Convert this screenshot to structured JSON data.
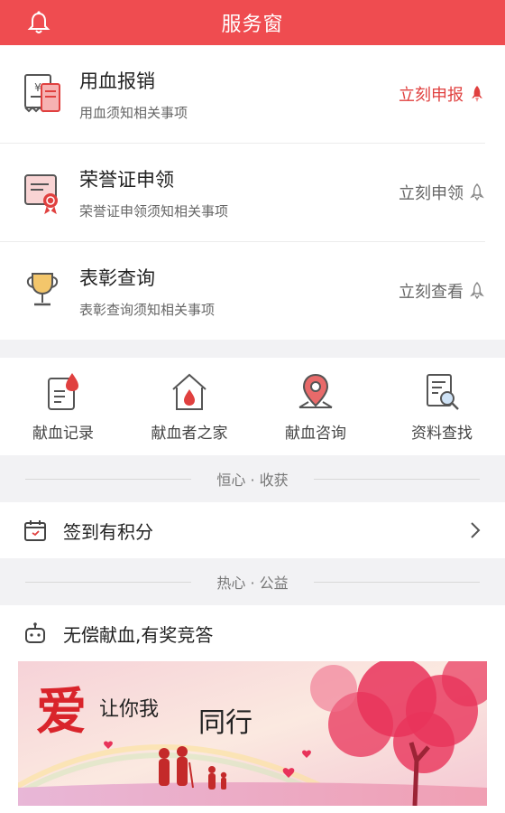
{
  "header": {
    "title": "服务窗",
    "bell_icon": "bell-icon"
  },
  "services": [
    {
      "title": "用血报销",
      "subtitle": "用血须知相关事项",
      "action": "立刻申报",
      "icon": "receipt-icon",
      "primary": true
    },
    {
      "title": "荣誉证申领",
      "subtitle": "荣誉证申领须知相关事项",
      "action": "立刻申领",
      "icon": "certificate-icon",
      "primary": false
    },
    {
      "title": "表彰查询",
      "subtitle": "表彰查询须知相关事项",
      "action": "立刻查看",
      "icon": "trophy-icon",
      "primary": false
    }
  ],
  "grid": [
    {
      "label": "献血记录",
      "icon": "blood-record-icon"
    },
    {
      "label": "献血者之家",
      "icon": "blood-home-icon"
    },
    {
      "label": "献血咨询",
      "icon": "location-pin-icon"
    },
    {
      "label": "资料查找",
      "icon": "document-search-icon"
    }
  ],
  "section1": {
    "divider": "恒心 · 收获",
    "item": "签到有积分"
  },
  "section2": {
    "divider": "热心 · 公益",
    "item": "无偿献血,有奖竞答"
  },
  "banner": {
    "text1": "爱",
    "text2": "让你我",
    "text3": "同行"
  },
  "colors": {
    "accent": "#ef4c50",
    "heart_pink": "#e8335a"
  }
}
